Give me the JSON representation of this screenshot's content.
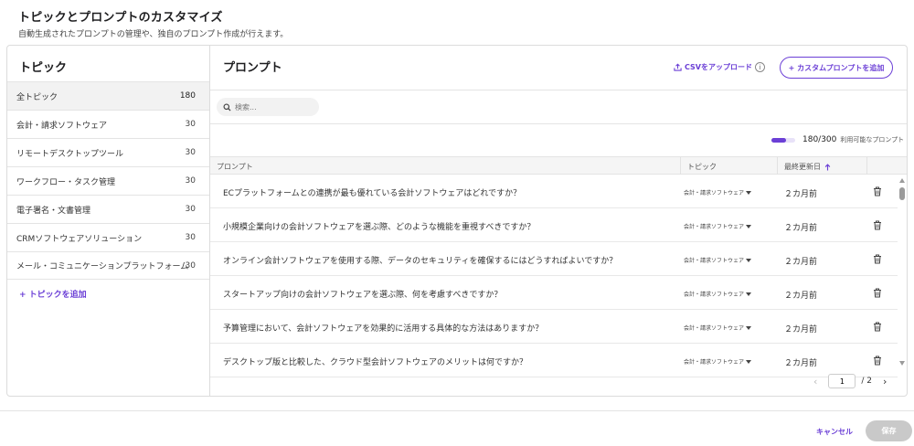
{
  "header": {
    "title": "トピックとプロンプトのカスタマイズ",
    "subtitle": "自動生成されたプロンプトの管理や、独自のプロンプト作成が行えます。"
  },
  "topics": {
    "title": "トピック",
    "items": [
      {
        "label": "全トピック",
        "count": "180"
      },
      {
        "label": "会計・請求ソフトウェア",
        "count": "30"
      },
      {
        "label": "リモートデスクトップツール",
        "count": "30"
      },
      {
        "label": "ワークフロー・タスク管理",
        "count": "30"
      },
      {
        "label": "電子署名・文書管理",
        "count": "30"
      },
      {
        "label": "CRMソフトウェアソリューション",
        "count": "30"
      },
      {
        "label": "メール・コミュニケーションプラットフォーム",
        "count": "30"
      }
    ],
    "add_label": "+ トピックを追加"
  },
  "prompts": {
    "title": "プロンプト",
    "csv_upload_label": "CSVをアップロード",
    "add_button_label": "+ カスタムプロンプトを追加",
    "search_placeholder": "検索...",
    "usage": {
      "count": "180/300",
      "label": "利用可能なプロンプト",
      "fraction": 0.6
    },
    "columns": {
      "prompt": "プロンプト",
      "topic": "トピック",
      "updated": "最終更新日",
      "sort_icon": "arrow-up-icon"
    },
    "rows": [
      {
        "prompt": "ECプラットフォームとの連携が最も優れている会計ソフトウェアはどれですか？",
        "topic": "会計・請求ソフトウェア",
        "updated": "２カ月前"
      },
      {
        "prompt": "小規模企業向けの会計ソフトウェアを選ぶ際、どのような機能を重視すべきですか？",
        "topic": "会計・請求ソフトウェア",
        "updated": "２カ月前"
      },
      {
        "prompt": "オンライン会計ソフトウェアを使用する際、データのセキュリティを確保するにはどうすればよいですか？",
        "topic": "会計・請求ソフトウェア",
        "updated": "２カ月前"
      },
      {
        "prompt": "スタートアップ向けの会計ソフトウェアを選ぶ際、何を考慮すべきですか？",
        "topic": "会計・請求ソフトウェア",
        "updated": "２カ月前"
      },
      {
        "prompt": "予算管理において、会計ソフトウェアを効果的に活用する具体的な方法はありますか？",
        "topic": "会計・請求ソフトウェア",
        "updated": "２カ月前"
      },
      {
        "prompt": "デスクトップ版と比較した、クラウド型会計ソフトウェアのメリットは何ですか？",
        "topic": "会計・請求ソフトウェア",
        "updated": "２カ月前"
      }
    ],
    "pagination": {
      "current": "1",
      "total": "/ 2"
    }
  },
  "footer": {
    "cancel_label": "キャンセル",
    "save_label": "保存"
  },
  "colors": {
    "accent": "#6b3fd6",
    "disabled": "#c9c9c9"
  }
}
